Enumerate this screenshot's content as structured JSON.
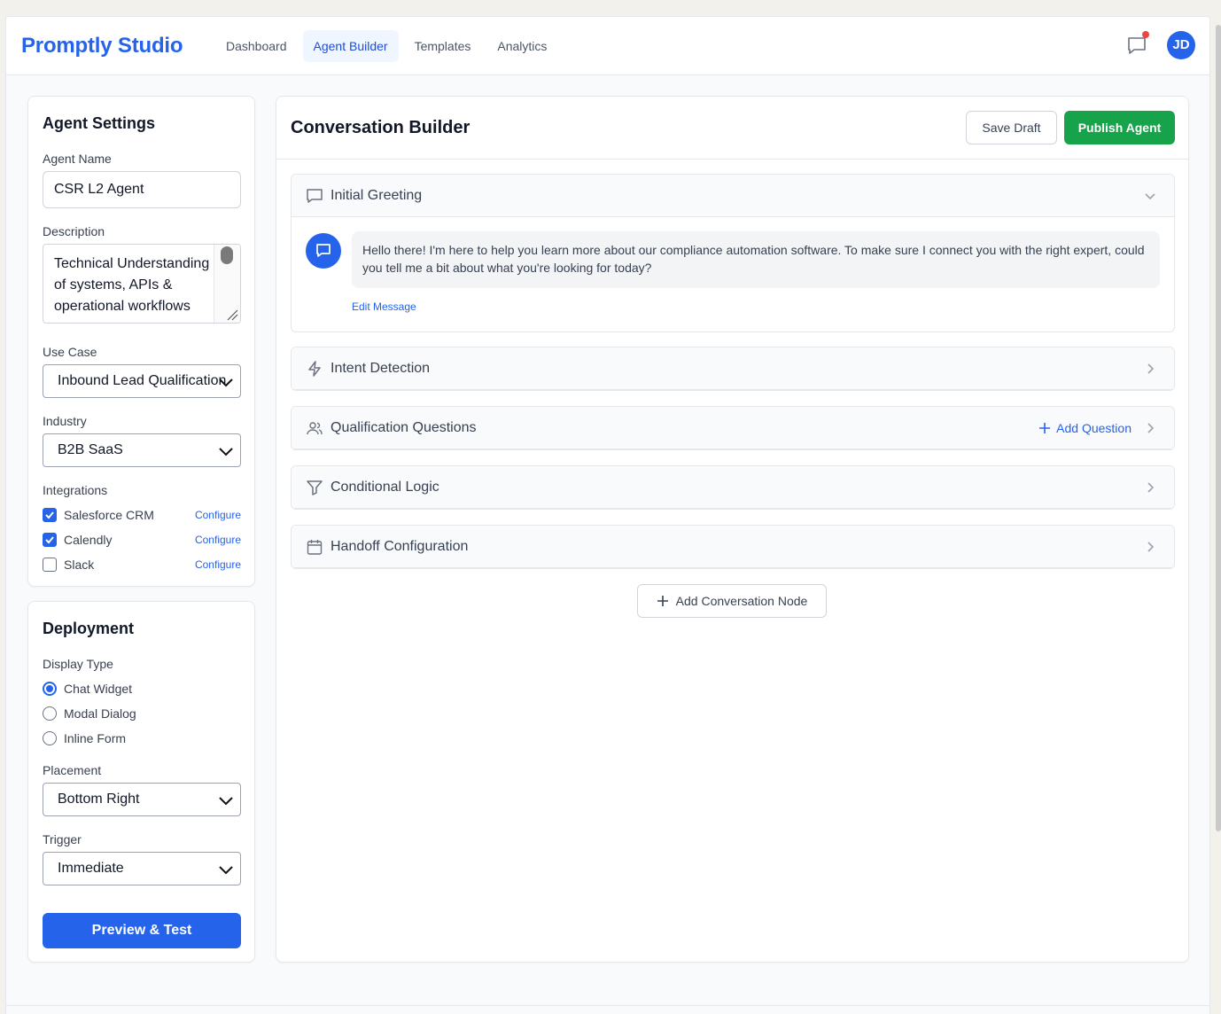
{
  "app": {
    "brand": "Promptly Studio",
    "user_initials": "JD"
  },
  "nav": [
    {
      "label": "Dashboard"
    },
    {
      "label": "Agent Builder"
    },
    {
      "label": "Templates"
    },
    {
      "label": "Analytics"
    }
  ],
  "agent_settings": {
    "title": "Agent Settings",
    "name_label": "Agent Name",
    "name_value": "CSR L2 Agent",
    "description_label": "Description",
    "description_value": "Technical Understanding of systems, APIs & operational workflows",
    "use_case_label": "Use Case",
    "use_case_value": "Inbound Lead Qualification",
    "industry_label": "Industry",
    "industry_value": "B2B SaaS",
    "integrations_label": "Integrations",
    "integrations": [
      {
        "name": "Salesforce CRM",
        "checked": true,
        "action": "Configure"
      },
      {
        "name": "Calendly",
        "checked": true,
        "action": "Configure"
      },
      {
        "name": "Slack",
        "checked": false,
        "action": "Configure"
      }
    ]
  },
  "deployment": {
    "title": "Deployment",
    "display_type_label": "Display Type",
    "display_types": [
      {
        "label": "Chat Widget",
        "selected": true
      },
      {
        "label": "Modal Dialog",
        "selected": false
      },
      {
        "label": "Inline Form",
        "selected": false
      }
    ],
    "placement_label": "Placement",
    "placement_value": "Bottom Right",
    "trigger_label": "Trigger",
    "trigger_value": "Immediate",
    "preview_button": "Preview & Test"
  },
  "builder": {
    "title": "Conversation Builder",
    "save_draft": "Save Draft",
    "publish": "Publish Agent",
    "nodes": [
      {
        "title": "Initial Greeting",
        "icon": "message-square-icon",
        "expanded": true,
        "message": "Hello there! I'm here to help you learn more about our compliance automation software. To make sure I connect you with the right expert, could you tell me a bit about what you're looking for today?",
        "edit_label": "Edit Message"
      },
      {
        "title": "Intent Detection",
        "icon": "zap-icon",
        "expanded": false
      },
      {
        "title": "Qualification Questions",
        "icon": "users-icon",
        "expanded": false,
        "action": "Add Question"
      },
      {
        "title": "Conditional Logic",
        "icon": "filter-icon",
        "expanded": false
      },
      {
        "title": "Handoff Configuration",
        "icon": "calendar-icon",
        "expanded": false
      }
    ],
    "add_node": "Add Conversation Node"
  },
  "colors": {
    "brand": "#2563eb",
    "publish": "#16a34a",
    "notification_dot": "#ef4444"
  }
}
